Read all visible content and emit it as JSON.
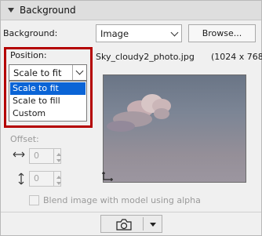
{
  "panel": {
    "title": "Background"
  },
  "background": {
    "label": "Background:",
    "type_value": "Image",
    "browse_label": "Browse..."
  },
  "position": {
    "label": "Position:",
    "selected": "Scale to fit",
    "options": [
      "Scale to fit",
      "Scale to fill",
      "Custom"
    ]
  },
  "image": {
    "filename": "Sky_cloudy2_photo.jpg",
    "dimensions": "(1024 x 768)"
  },
  "offset": {
    "label": "Offset:",
    "x_value": "0",
    "y_value": "0"
  },
  "blend": {
    "label": "Blend image with model using alpha",
    "checked": false
  },
  "colors": {
    "highlight": "#b40000",
    "selection": "#0a64d6"
  },
  "icons": [
    "panel-collapse-icon",
    "chevron-down-icon",
    "horizontal-arrow-icon",
    "vertical-arrow-icon",
    "camera-icon",
    "dropdown-arrow-icon"
  ]
}
